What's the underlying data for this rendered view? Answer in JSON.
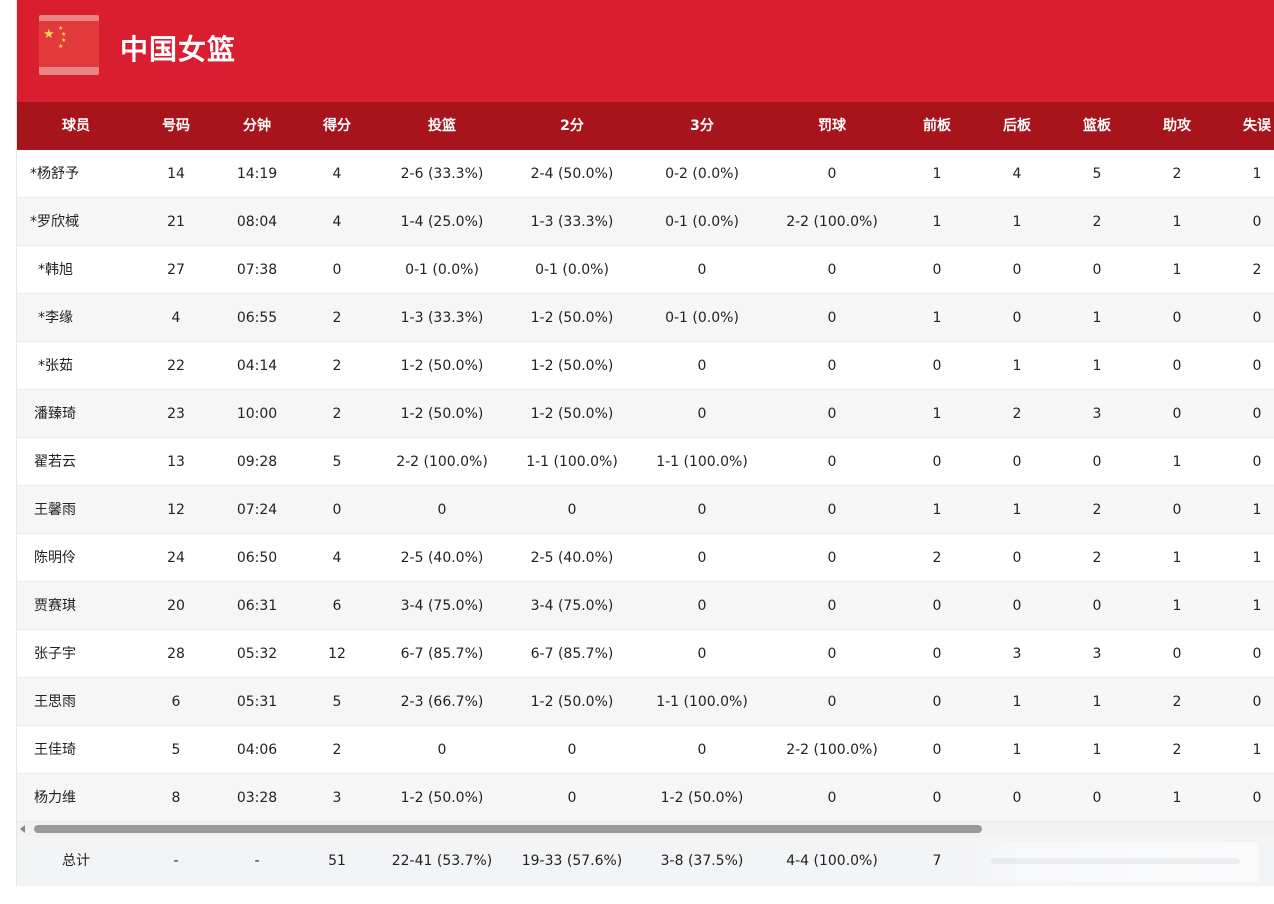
{
  "team": {
    "name": "中国女篮",
    "flag_icon": "china-flag-icon",
    "header_color": "#d81e2f",
    "table_header_color": "#a8141c"
  },
  "columns": [
    "球员",
    "号码",
    "分钟",
    "得分",
    "投篮",
    "2分",
    "3分",
    "罚球",
    "前板",
    "后板",
    "篮板",
    "助攻",
    "失误"
  ],
  "rows": [
    [
      "*杨舒予",
      "14",
      "14:19",
      "4",
      "2-6 (33.3%)",
      "2-4 (50.0%)",
      "0-2 (0.0%)",
      "0",
      "1",
      "4",
      "5",
      "2",
      "1"
    ],
    [
      "*罗欣棫",
      "21",
      "08:04",
      "4",
      "1-4 (25.0%)",
      "1-3 (33.3%)",
      "0-1 (0.0%)",
      "2-2 (100.0%)",
      "1",
      "1",
      "2",
      "1",
      "0"
    ],
    [
      "*韩旭",
      "27",
      "07:38",
      "0",
      "0-1 (0.0%)",
      "0-1 (0.0%)",
      "0",
      "0",
      "0",
      "0",
      "0",
      "1",
      "2"
    ],
    [
      "*李缘",
      "4",
      "06:55",
      "2",
      "1-3 (33.3%)",
      "1-2 (50.0%)",
      "0-1 (0.0%)",
      "0",
      "1",
      "0",
      "1",
      "0",
      "0"
    ],
    [
      "*张茹",
      "22",
      "04:14",
      "2",
      "1-2 (50.0%)",
      "1-2 (50.0%)",
      "0",
      "0",
      "0",
      "1",
      "1",
      "0",
      "0"
    ],
    [
      "潘臻琦",
      "23",
      "10:00",
      "2",
      "1-2 (50.0%)",
      "1-2 (50.0%)",
      "0",
      "0",
      "1",
      "2",
      "3",
      "0",
      "0"
    ],
    [
      "翟若云",
      "13",
      "09:28",
      "5",
      "2-2 (100.0%)",
      "1-1 (100.0%)",
      "1-1 (100.0%)",
      "0",
      "0",
      "0",
      "0",
      "1",
      "0"
    ],
    [
      "王馨雨",
      "12",
      "07:24",
      "0",
      "0",
      "0",
      "0",
      "0",
      "1",
      "1",
      "2",
      "0",
      "1"
    ],
    [
      "陈明伶",
      "24",
      "06:50",
      "4",
      "2-5 (40.0%)",
      "2-5 (40.0%)",
      "0",
      "0",
      "2",
      "0",
      "2",
      "1",
      "1"
    ],
    [
      "贾赛琪",
      "20",
      "06:31",
      "6",
      "3-4 (75.0%)",
      "3-4 (75.0%)",
      "0",
      "0",
      "0",
      "0",
      "0",
      "1",
      "1"
    ],
    [
      "张子宇",
      "28",
      "05:32",
      "12",
      "6-7 (85.7%)",
      "6-7 (85.7%)",
      "0",
      "0",
      "0",
      "3",
      "3",
      "0",
      "0"
    ],
    [
      "王思雨",
      "6",
      "05:31",
      "5",
      "2-3 (66.7%)",
      "1-2 (50.0%)",
      "1-1 (100.0%)",
      "0",
      "0",
      "1",
      "1",
      "2",
      "0"
    ],
    [
      "王佳琦",
      "5",
      "04:06",
      "2",
      "0",
      "0",
      "0",
      "2-2 (100.0%)",
      "0",
      "1",
      "1",
      "2",
      "1"
    ],
    [
      "杨力维",
      "8",
      "03:28",
      "3",
      "1-2 (50.0%)",
      "0",
      "1-2 (50.0%)",
      "0",
      "0",
      "0",
      "0",
      "1",
      "0"
    ]
  ],
  "totals": {
    "label": "总计",
    "number": "-",
    "minutes": "-",
    "points": "51",
    "fg": "22-41 (53.7%)",
    "two": "19-33 (57.6%)",
    "three": "3-8 (37.5%)",
    "ft": "4-4 (100.0%)",
    "oreb": "7"
  },
  "scrollbar": {
    "position": "left"
  }
}
